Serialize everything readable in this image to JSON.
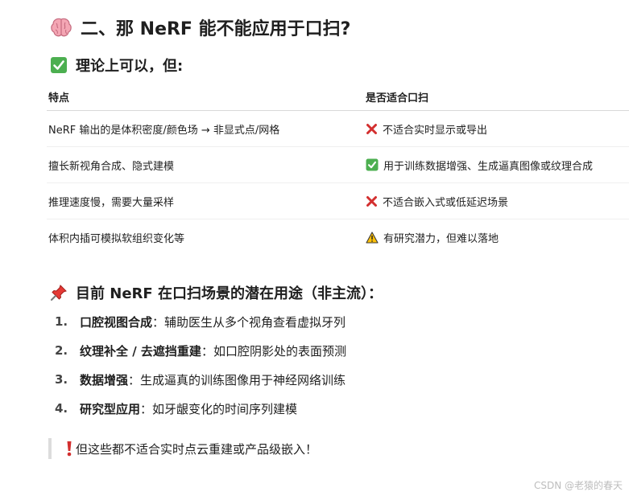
{
  "heading": {
    "icon": "brain-icon",
    "text": "二、那 NeRF 能不能应用于口扫?"
  },
  "subheading_theory": {
    "icon": "check-mark-icon",
    "text": "理论上可以，但:"
  },
  "table": {
    "headers": [
      "特点",
      "是否适合口扫"
    ],
    "rows": [
      {
        "feature": "NeRF 输出的是体积密度/颜色场 → 非显式点/网格",
        "icon": "cross-mark-icon",
        "verdict": "不适合实时显示或导出"
      },
      {
        "feature": "擅长新视角合成、隐式建模",
        "icon": "check-mark-icon",
        "verdict": "用于训练数据增强、生成逼真图像或纹理合成"
      },
      {
        "feature": "推理速度慢，需要大量采样",
        "icon": "cross-mark-icon",
        "verdict": "不适合嵌入式或低延迟场景"
      },
      {
        "feature": "体积内插可模拟软组织变化等",
        "icon": "warning-icon",
        "verdict": "有研究潜力，但难以落地"
      }
    ]
  },
  "subheading_uses": {
    "icon": "pushpin-icon",
    "text": "目前 NeRF 在口扫场景的潜在用途（非主流）："
  },
  "uses": [
    {
      "num": "1.",
      "title": "口腔视图合成",
      "sep": "：",
      "desc": "辅助医生从多个视角查看虚拟牙列"
    },
    {
      "num": "2.",
      "title": "纹理补全 / 去遮挡重建",
      "sep": "：",
      "desc": "如口腔阴影处的表面预测"
    },
    {
      "num": "3.",
      "title": "数据增强",
      "sep": "：",
      "desc": "生成逼真的训练图像用于神经网络训练"
    },
    {
      "num": "4.",
      "title": "研究型应用",
      "sep": "：",
      "desc": "如牙龈变化的时间序列建模"
    }
  ],
  "note": {
    "icon": "exclamation-icon",
    "text": "但这些都不适合实时点云重建或产品级嵌入！"
  },
  "watermark": "CSDN @老猿的春天",
  "colors": {
    "check_green": "#4caf50",
    "cross_red": "#d32f2f",
    "warning_yellow": "#ffc107",
    "pin_red": "#e53935",
    "brain_pink": "#f4a6b4"
  }
}
